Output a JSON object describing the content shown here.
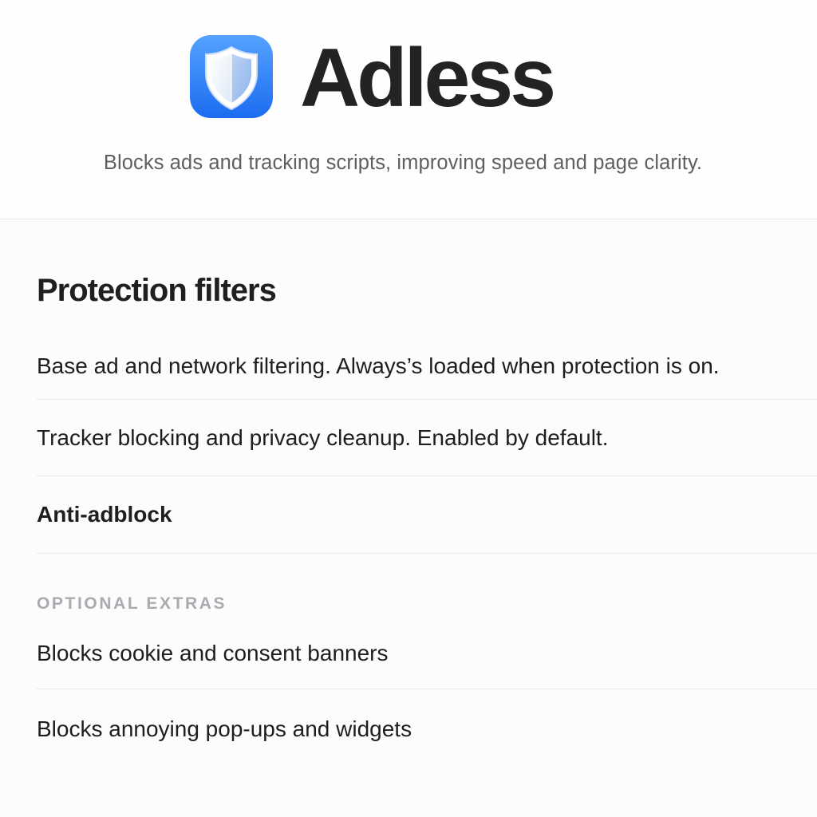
{
  "app": {
    "name": "Adless",
    "icon": "shield-icon",
    "tagline": "Blocks ads and tracking scripts, improving speed and page clarity."
  },
  "protection": {
    "title": "Protection filters",
    "items": [
      {
        "label": "Base ad and network filtering. Always’s loaded when protection is on."
      },
      {
        "label": "Tracker blocking and privacy cleanup. Enabled by default."
      },
      {
        "label": "Anti-adblock"
      }
    ]
  },
  "extras": {
    "header": "OPTIONAL EXTRAS",
    "items": [
      {
        "label": "Blocks cookie and consent banners"
      },
      {
        "label": "Blocks annoying pop-ups and widgets"
      }
    ]
  },
  "colors": {
    "icon_gradient_top": "#4d9bff",
    "icon_gradient_bottom": "#1f6ff0",
    "text_primary": "#1d1d1f",
    "text_secondary": "#5f5f62",
    "group_header": "#a8acb0",
    "divider": "#e9e9e9"
  }
}
